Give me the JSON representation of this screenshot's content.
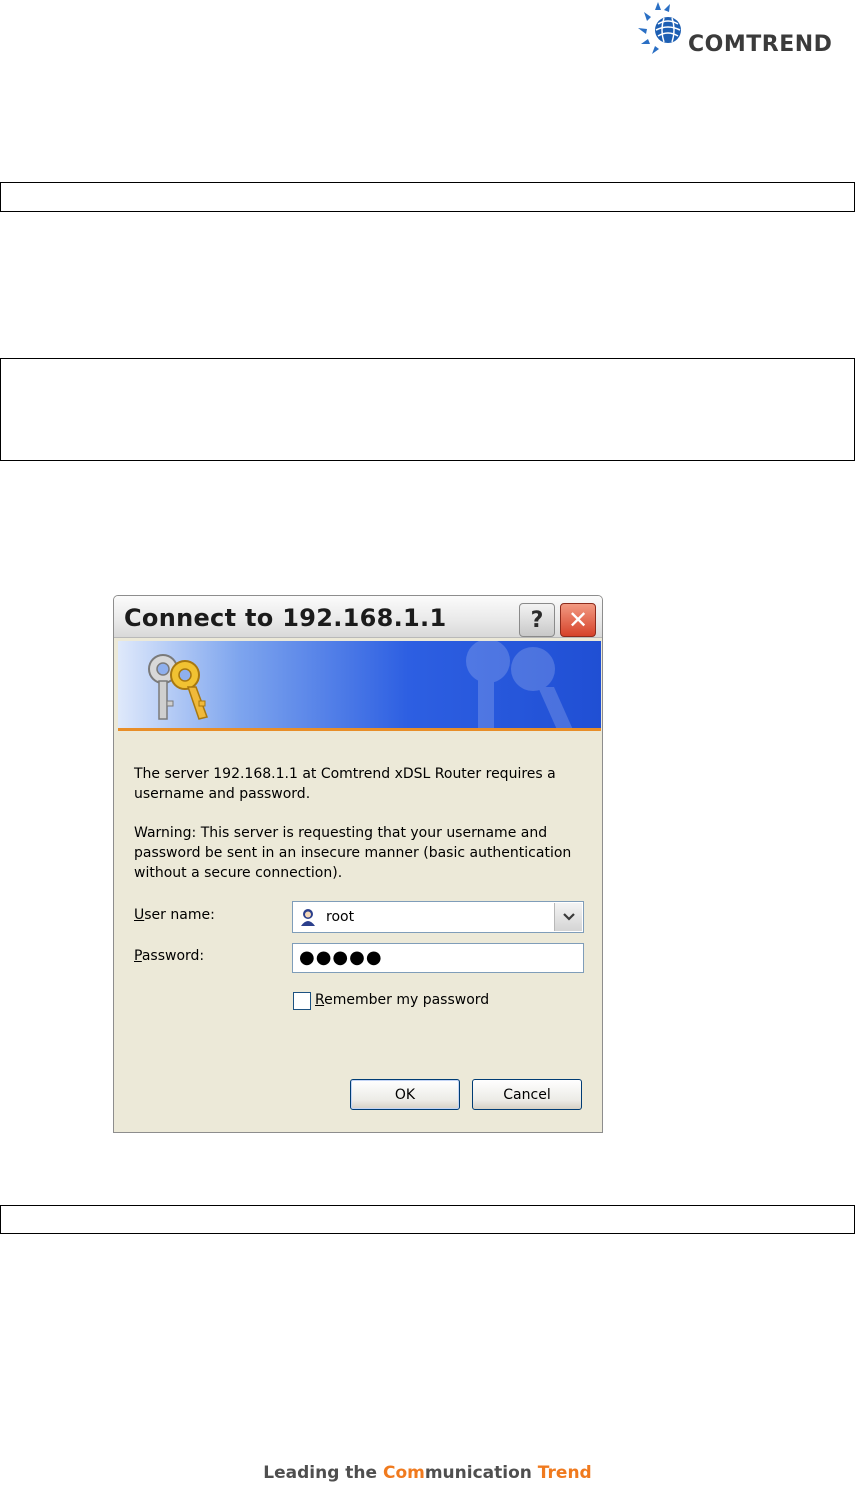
{
  "logo": {
    "name": "COMTREND"
  },
  "dialog": {
    "title": "Connect to 192.168.1.1",
    "help_label": "?",
    "close_label": "✕",
    "message": "The server 192.168.1.1 at Comtrend xDSL Router requires a username and password.",
    "warning": "Warning: This server is requesting that your username and password be sent in an insecure manner (basic authentication without a secure connection).",
    "username_label_prefix": "U",
    "username_label_rest": "ser name:",
    "username_value": "root",
    "password_label_prefix": "P",
    "password_label_rest": "assword:",
    "password_value": "●●●●●",
    "remember_prefix": "R",
    "remember_rest": "emember my password",
    "remember_checked": false,
    "ok_label": "OK",
    "cancel_label": "Cancel"
  },
  "footer": {
    "part1": "Leading the ",
    "part2": "Com",
    "part3": "munication ",
    "part4": "Trend"
  },
  "colors": {
    "accent": "#f07a1e",
    "banner_blue": "#2d5fe2",
    "close_red": "#d6422a"
  }
}
